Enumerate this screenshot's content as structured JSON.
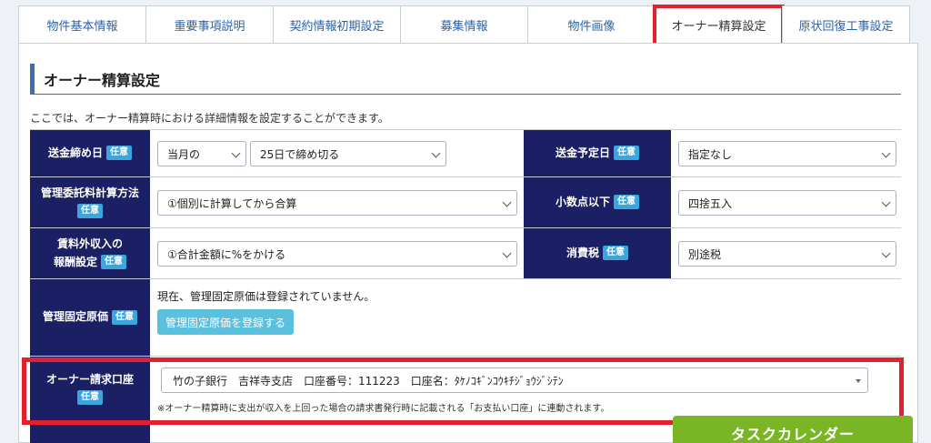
{
  "tabs": [
    {
      "label": "物件基本情報",
      "active": false
    },
    {
      "label": "重要事項説明",
      "active": false
    },
    {
      "label": "契約情報初期設定",
      "active": false
    },
    {
      "label": "募集情報",
      "active": false
    },
    {
      "label": "物件画像",
      "active": false
    },
    {
      "label": "オーナー精算設定",
      "active": true
    },
    {
      "label": "原状回復工事設定",
      "active": false
    }
  ],
  "section": {
    "title": "オーナー精算設定",
    "description": "ここでは、オーナー精算時における詳細情報を設定することができます。"
  },
  "badge_label": "任意",
  "form": {
    "closing_day": {
      "label": "送金締め日",
      "month_value": "当月の",
      "day_value": "25日で締め切る"
    },
    "transfer_date": {
      "label": "送金予定日",
      "value": "指定なし"
    },
    "calc_method": {
      "label": "管理委託料計算方法",
      "value": "①個別に計算してから合算"
    },
    "decimal": {
      "label": "小数点以下",
      "value": "四捨五入"
    },
    "non_rent_income": {
      "label_line1": "賃料外収入の",
      "label_line2": "報酬設定",
      "value": "①合計金額に%をかける"
    },
    "consumption_tax": {
      "label": "消費税",
      "value": "別途税"
    },
    "fixed_cost": {
      "label": "管理固定原価",
      "status_text": "現在、管理固定原価は登録されていません。",
      "button_label": "管理固定原価を登録する"
    },
    "owner_account": {
      "label": "オーナー請求口座",
      "value": "竹の子銀行　吉祥寺支店　口座番号：111223　口座名：ﾀｹﾉｺｷﾞﾝｺｳｷﾁｼﾞｮｳｼﾞｼﾃﾝ",
      "note": "※オーナー精算時に支出が収入を上回った場合の請求書発行時に記載される「お支払い口座」に連動されます。"
    }
  },
  "floating_button": {
    "label": "タスクカレンダー"
  },
  "colors": {
    "label_bg": "#1b1f63",
    "badge": "#3aa6dc",
    "highlight": "#e5202e",
    "primary_button": "#5bc0de",
    "green": "#7ab526"
  }
}
